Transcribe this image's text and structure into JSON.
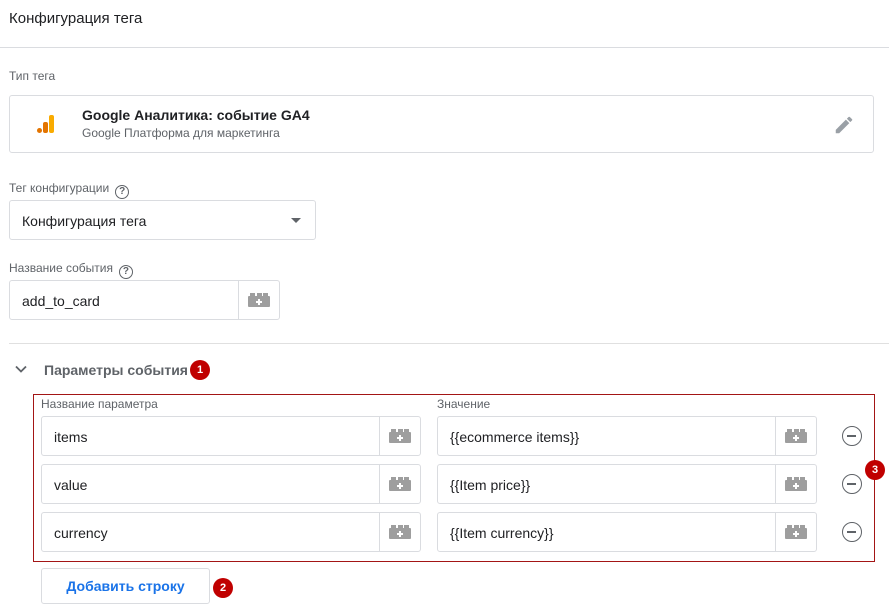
{
  "header": {
    "title": "Конфигурация тега"
  },
  "tag_type": {
    "label": "Тип тега",
    "name": "Google Аналитика: событие GA4",
    "subtitle": "Google Платформа для маркетинга",
    "logo_icon": "google-analytics-icon",
    "edit_icon": "pencil-icon"
  },
  "config_tag": {
    "label": "Тег конфигурации",
    "selected": "Конфигурация тега"
  },
  "event_name": {
    "label": "Название события",
    "value": "add_to_card"
  },
  "event_params": {
    "title": "Параметры события",
    "badge": "1",
    "col_name": "Название параметра",
    "col_value": "Значение",
    "rows": [
      {
        "name": "items",
        "value": "{{ecommerce items}}"
      },
      {
        "name": "value",
        "value": "{{Item price}}"
      },
      {
        "name": "currency",
        "value": "{{Item currency}}"
      }
    ],
    "box_badge": "3",
    "add_row_label": "Добавить строку",
    "add_row_badge": "2"
  },
  "colors": {
    "accent": "#1a73e8",
    "badge": "#c00000",
    "box_border": "#a31515"
  }
}
